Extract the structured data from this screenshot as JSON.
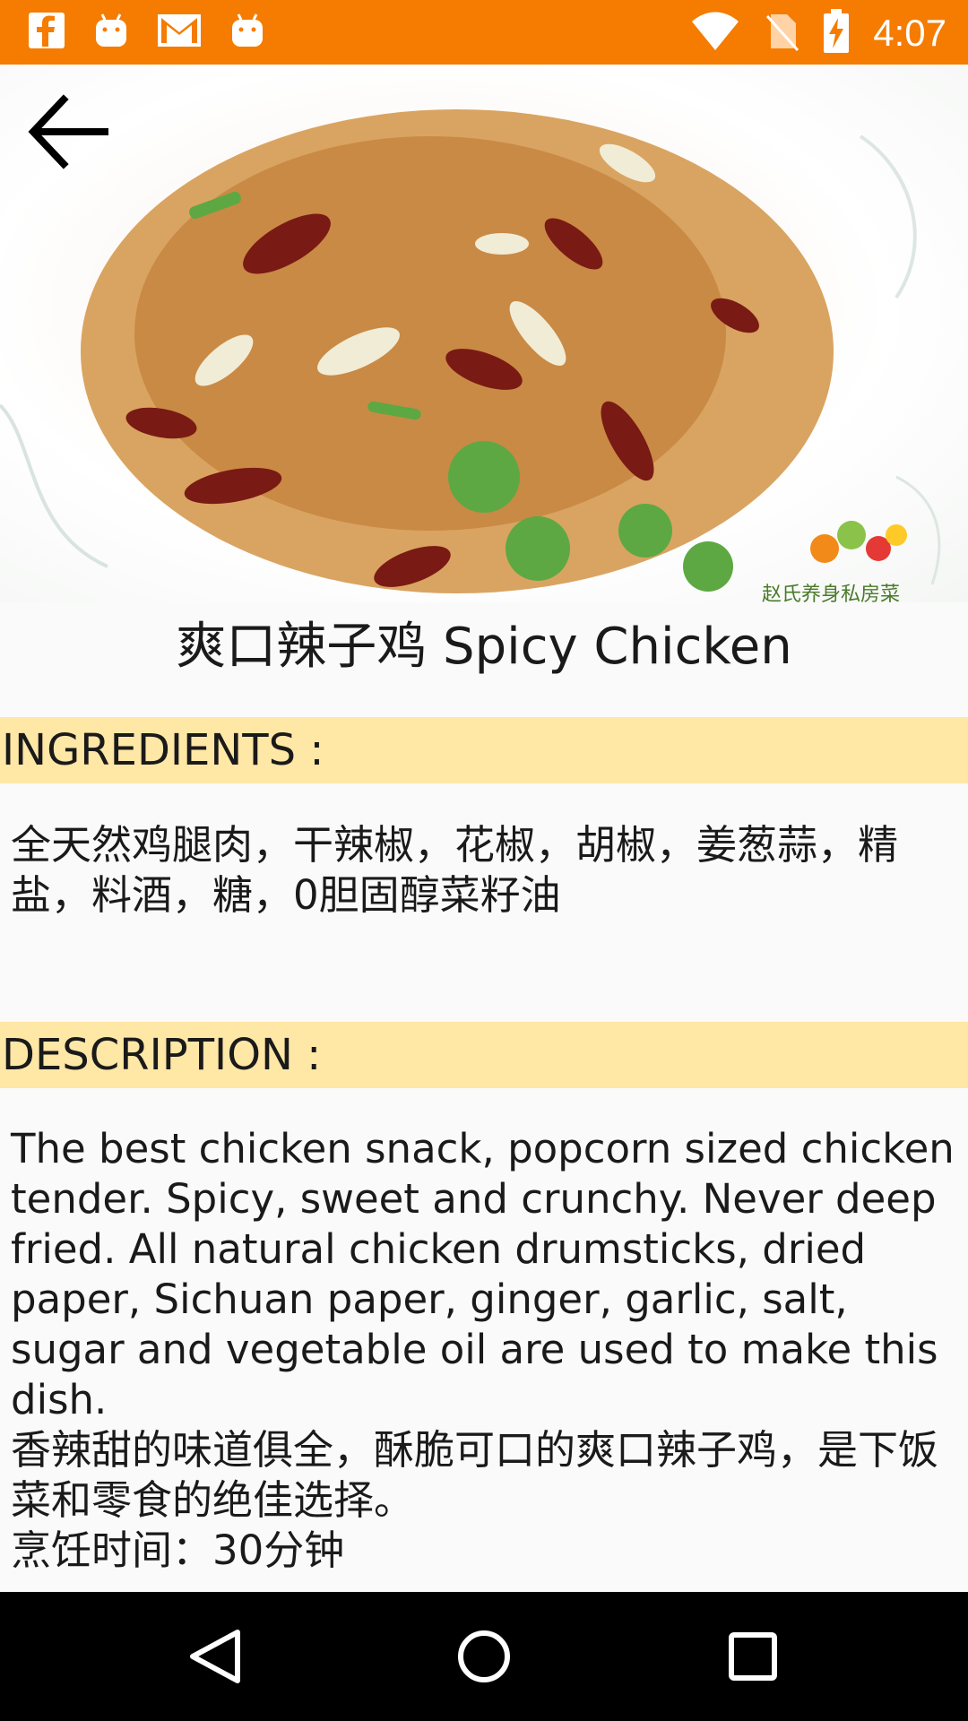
{
  "status_bar": {
    "time": "4:07",
    "left_icons": [
      "facebook-icon",
      "android-icon",
      "gmail-icon",
      "android-icon"
    ],
    "right_icons": [
      "wifi-icon",
      "no-sim-icon",
      "battery-charging-icon"
    ],
    "color": "#f57c00"
  },
  "recipe": {
    "title": "爽口辣子鸡 Spicy Chicken",
    "ingredients_header": "INGREDIENTS :",
    "ingredients_text": "全天然鸡腿肉，干辣椒，花椒，胡椒，姜葱蒜，精盐，料酒，糖，0胆固醇菜籽油",
    "description_header": "DESCRIPTION :",
    "description_text": "The best chicken snack, popcorn sized chicken tender. Spicy, sweet and crunchy. Never deep fried. All natural chicken drumsticks, dried paper, Sichuan paper, ginger, garlic, salt, sugar and vegetable oil are used to make this dish.\n香辣甜的味道俱全，酥脆可口的爽口辣子鸡，是下饭菜和零食的绝佳选择。\n烹饪时间：30分钟",
    "watermark": "赵氏养身私房菜"
  },
  "nav": {
    "back": "back-icon",
    "home": "home-icon",
    "recents": "recents-icon"
  },
  "colors": {
    "section_header_bg": "#ffe7a6",
    "page_bg": "#fafafa"
  }
}
